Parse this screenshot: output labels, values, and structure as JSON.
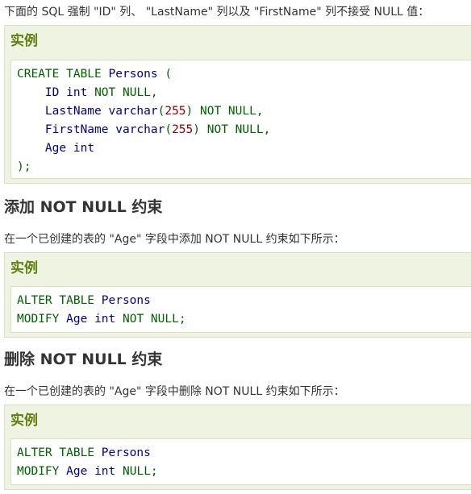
{
  "intro_text": "下面的 SQL 强制 \"ID\" 列、 \"LastName\" 列以及 \"FirstName\" 列不接受 NULL 值：",
  "example_label": "实例",
  "create_table_code": {
    "line1": {
      "kw1": "CREATE TABLE",
      "name": "Persons",
      "paren": "("
    },
    "line2": {
      "col": "ID",
      "type": "int",
      "constraint": "NOT NULL",
      "punct": ","
    },
    "line3": {
      "col": "LastName",
      "type": "varchar",
      "open": "(",
      "num": "255",
      "close": ")",
      "constraint": "NOT NULL",
      "punct": ","
    },
    "line4": {
      "col": "FirstName",
      "type": "varchar",
      "open": "(",
      "num": "255",
      "close": ")",
      "constraint": "NOT NULL",
      "punct": ","
    },
    "line5": {
      "col": "Age",
      "type": "int"
    },
    "line6": {
      "end": ");"
    }
  },
  "section_add": {
    "heading": "添加 NOT NULL 约束",
    "description": "在一个已创建的表的 \"Age\" 字段中添加 NOT NULL 约束如下所示：",
    "code": {
      "line1": {
        "kw": "ALTER TABLE",
        "name": "Persons"
      },
      "line2": {
        "kw": "MODIFY",
        "col": "Age",
        "type": "int",
        "constraint": "NOT NULL",
        "end": ";"
      }
    }
  },
  "section_remove": {
    "heading": "删除 NOT NULL 约束",
    "description": "在一个已创建的表的 \"Age\" 字段中删除 NOT NULL 约束如下所示：",
    "code": {
      "line1": {
        "kw": "ALTER TABLE",
        "name": "Persons"
      },
      "line2": {
        "kw": "MODIFY",
        "col": "Age",
        "type": "int",
        "constraint": "NULL",
        "end": ";"
      }
    }
  },
  "colors": {
    "keyword": "#006000",
    "identifier": "#000088",
    "number": "#880000",
    "example_title": "#617f10",
    "example_bg": "#eef3e2"
  }
}
